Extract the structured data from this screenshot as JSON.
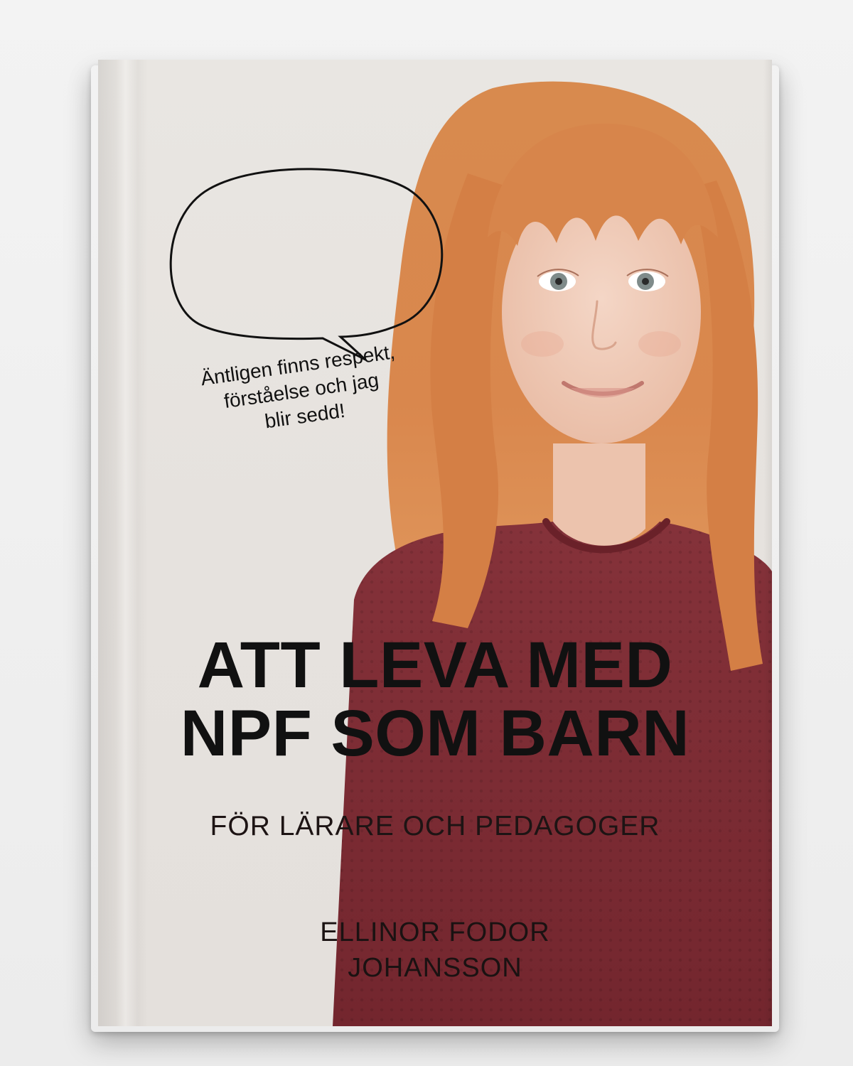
{
  "cover": {
    "speech_bubble": {
      "lines": [
        "Äntligen finns respekt,",
        "förståelse och jag",
        "blir sedd!"
      ]
    },
    "title": {
      "line1": "ATT LEVA MED",
      "line2": "NPF SOM BARN"
    },
    "subtitle": "FÖR LÄRARE OCH PEDAGOGER",
    "author": {
      "line1": "ELLINOR FODOR",
      "line2": "JOHANSSON"
    }
  },
  "colors": {
    "background": "#efefef",
    "cover": "#e6e2de",
    "hair": "#d7864f",
    "shirt": "#7b2a32",
    "skin": "#f0ccb8",
    "text": "#111111"
  }
}
